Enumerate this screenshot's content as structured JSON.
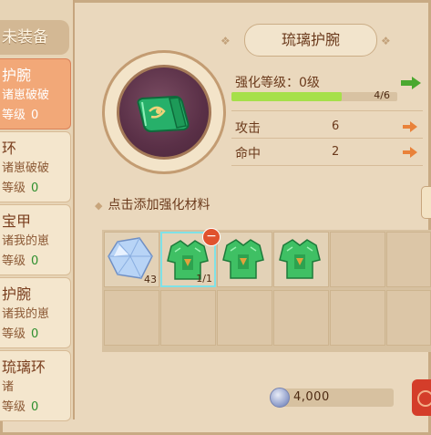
{
  "left_panel": {
    "header": "未装备",
    "items": [
      {
        "name": "护腕",
        "sub": "诸崽破破",
        "level_label": "等级",
        "level": "0"
      },
      {
        "name": "环",
        "sub": "诸崽破破",
        "level_label": "等级",
        "level": "0"
      },
      {
        "name": "宝甲",
        "sub": "诸我的崽",
        "level_label": "等级",
        "level": "0"
      },
      {
        "name": "护腕",
        "sub": "诸我的崽",
        "level_label": "等级",
        "level": "0"
      },
      {
        "name": "琉璃环",
        "sub": "诸",
        "level_label": "等级",
        "level": "0"
      }
    ]
  },
  "equipment": {
    "title": "琉璃护腕",
    "icon": "jade-gauntlet-icon"
  },
  "stats": {
    "enhance_label": "强化等级：0级",
    "progress_text": "4/6",
    "progress": 0.6667,
    "attack_label": "攻击",
    "attack_value": "6",
    "hit_label": "命中",
    "hit_value": "2"
  },
  "hint": "点击添加强化材料",
  "materials": [
    {
      "icon": "crystal-icon",
      "count": "43"
    },
    {
      "icon": "jade-armor-icon",
      "count": "1/1"
    },
    {
      "icon": "jade-armor-icon",
      "count": ""
    },
    {
      "icon": "jade-armor-icon",
      "count": ""
    }
  ],
  "cost": {
    "icon": "silver-coin-icon",
    "value": "4,000"
  },
  "colors": {
    "selected_item": "#f2a878",
    "progress": "#a6e04a",
    "level_number": "#2e8f2e",
    "arrow_orange": "#e9823a",
    "arrow_green": "#4aa82f",
    "confirm_button": "#d43d2a"
  }
}
